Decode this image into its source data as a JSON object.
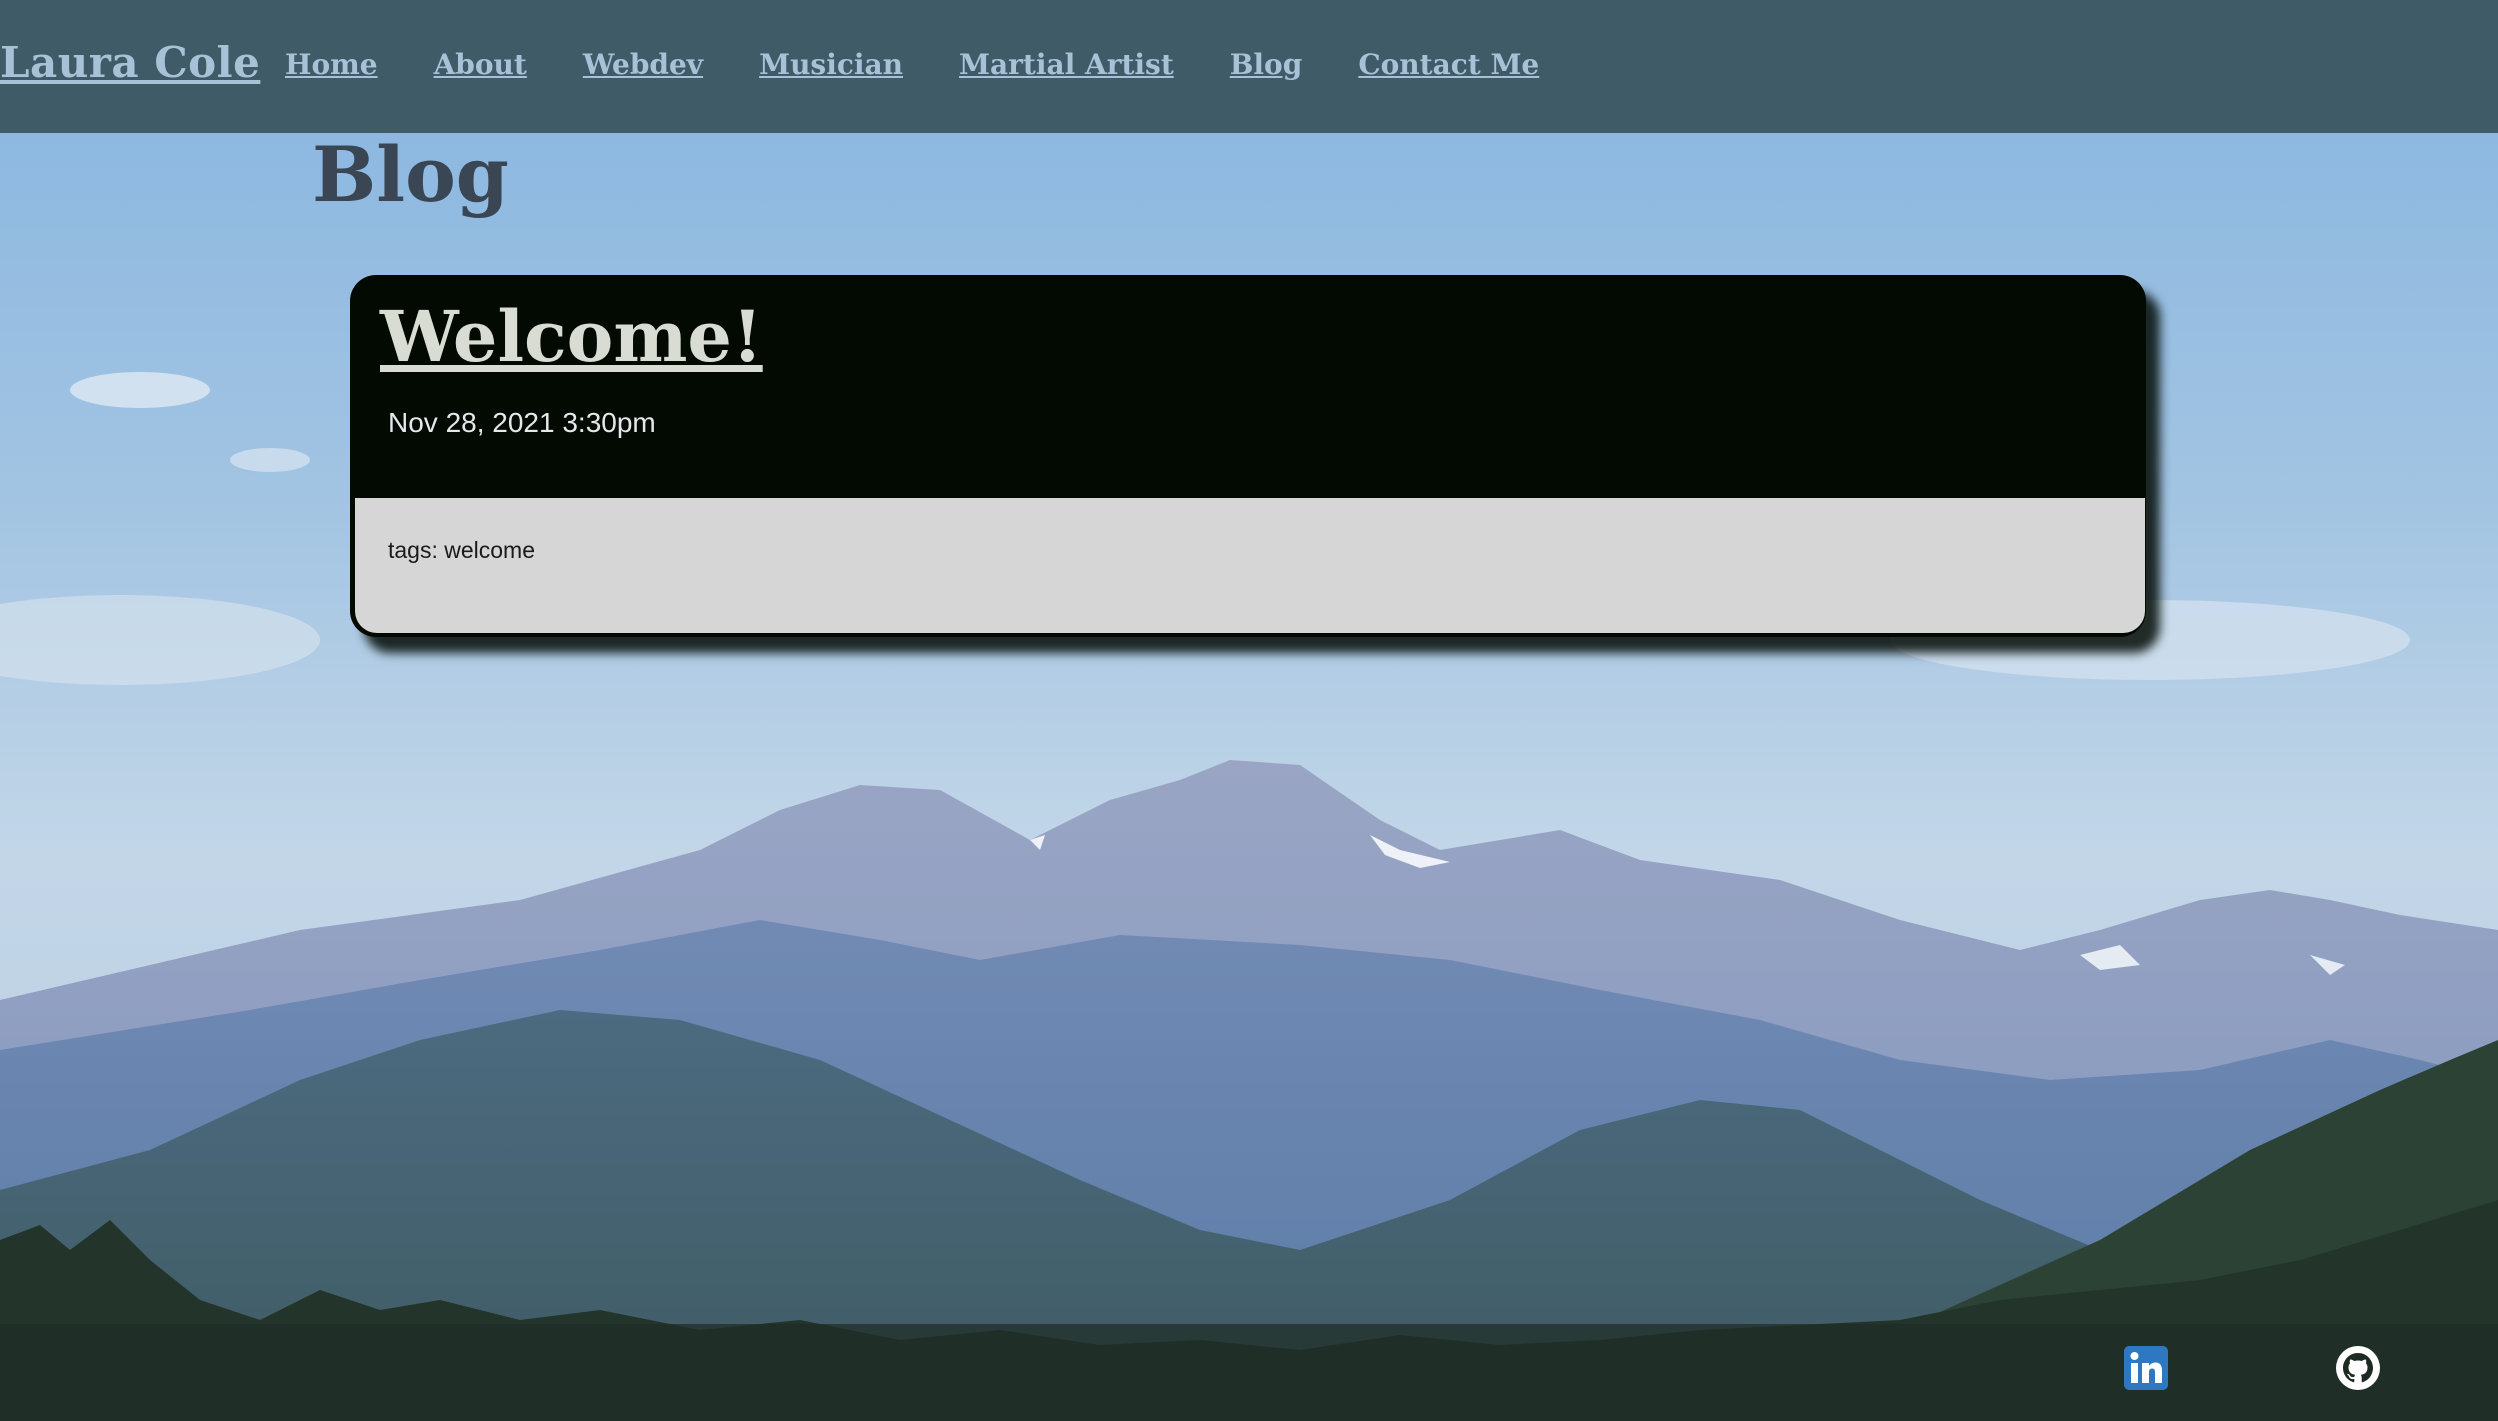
{
  "nav": {
    "brand": "Laura Cole",
    "links": [
      {
        "label": "Home"
      },
      {
        "label": "About"
      },
      {
        "label": "Webdev"
      },
      {
        "label": "Musician"
      },
      {
        "label": "Martial Artist"
      },
      {
        "label": "Blog"
      },
      {
        "label": "Contact Me"
      }
    ]
  },
  "page": {
    "title": "Blog"
  },
  "post": {
    "title": "Welcome!",
    "date": "Nov 28, 2021 3:30pm",
    "tags": "tags: welcome"
  },
  "footer": {
    "icons": [
      "linkedin-icon",
      "github-icon"
    ]
  },
  "colors": {
    "navbar": "#3f5b68",
    "nav_text": "#a9c1d6",
    "card_dark": "#020a02",
    "card_light": "#d6d6d6",
    "heading": "#3a4654"
  }
}
